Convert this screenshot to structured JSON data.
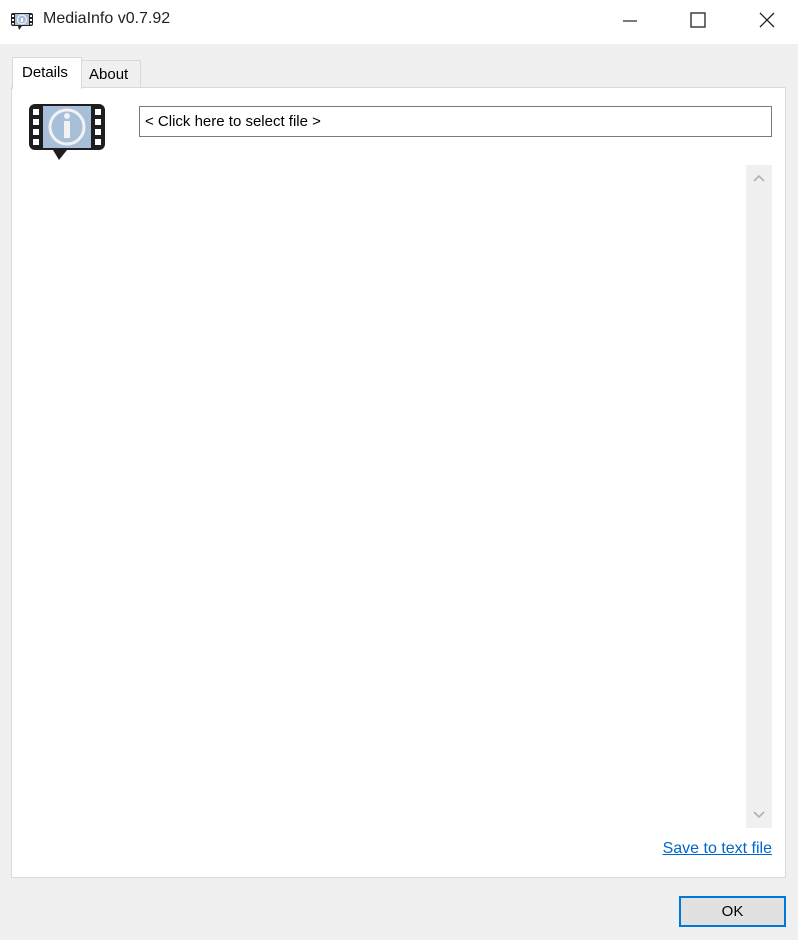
{
  "window": {
    "title": "MediaInfo v0.7.92",
    "controls": [
      "minimize",
      "maximize",
      "close"
    ]
  },
  "tabs": [
    {
      "label": "Details",
      "active": true
    },
    {
      "label": "About",
      "active": false
    }
  ],
  "file_selector": {
    "value": "< Click here to select file >"
  },
  "icons": {
    "app": "mediainfo-film-info-icon",
    "logo": "mediainfo-film-info-icon",
    "minimize": "minimize-icon",
    "maximize": "maximize-icon",
    "close": "close-icon",
    "scroll_up": "chevron-up-icon",
    "scroll_down": "chevron-down-icon"
  },
  "colors": {
    "link": "#0066cc",
    "focus_border": "#0078d7",
    "logo_fill": "#a7bfd9"
  },
  "footer": {
    "save_link": "Save to text file",
    "ok_label": "OK"
  }
}
